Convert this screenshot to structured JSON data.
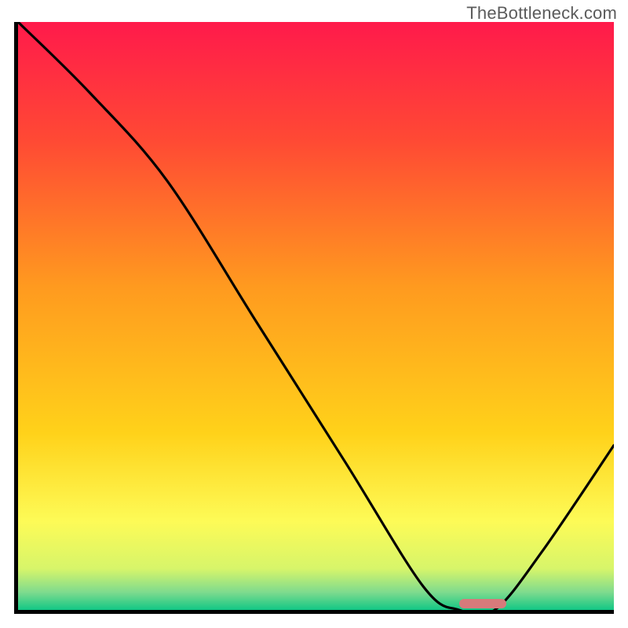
{
  "watermark": "TheBottleneck.com",
  "chart_data": {
    "type": "line",
    "title": "",
    "xlabel": "",
    "ylabel": "",
    "xlim": [
      0,
      100
    ],
    "ylim": [
      0,
      100
    ],
    "grid": false,
    "legend": false,
    "series": [
      {
        "name": "bottleneck-curve",
        "x": [
          0,
          12,
          25,
          40,
          55,
          68,
          74,
          80,
          88,
          100
        ],
        "y": [
          100,
          88,
          73,
          49,
          25,
          4,
          0,
          0,
          10,
          28
        ]
      }
    ],
    "optimal_range_x": [
      74,
      82
    ],
    "gradient_stops": [
      {
        "pos": 0.0,
        "color": "#ff1a4b"
      },
      {
        "pos": 0.2,
        "color": "#ff4934"
      },
      {
        "pos": 0.45,
        "color": "#ff9a1f"
      },
      {
        "pos": 0.7,
        "color": "#ffd21a"
      },
      {
        "pos": 0.85,
        "color": "#fdfb57"
      },
      {
        "pos": 0.93,
        "color": "#d7f56a"
      },
      {
        "pos": 0.97,
        "color": "#7edb8e"
      },
      {
        "pos": 1.0,
        "color": "#12c785"
      }
    ]
  }
}
